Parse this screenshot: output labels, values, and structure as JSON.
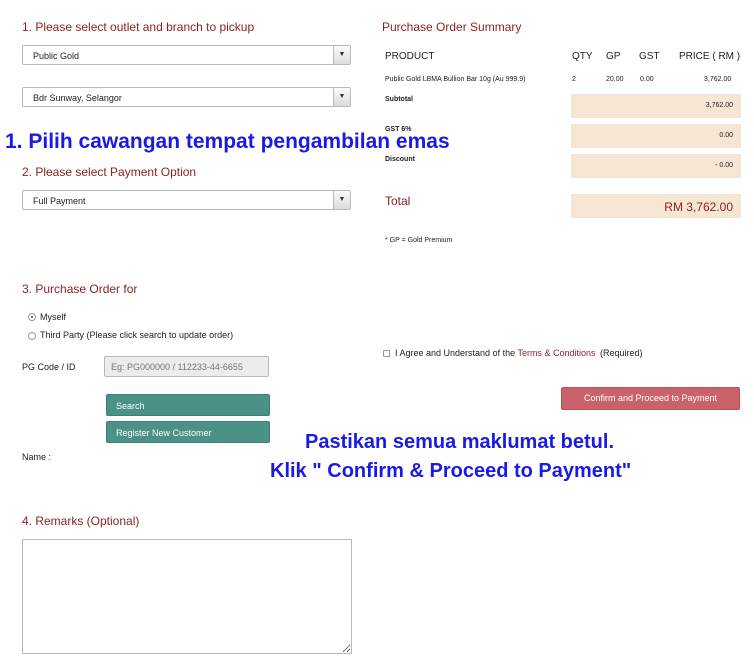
{
  "pickup": {
    "title": "1. Please select outlet and branch to pickup",
    "outlet": "Public Gold",
    "branch": "Bdr Sunway, Selangor"
  },
  "overlay_top": "1. Pilih cawangan tempat pengambilan emas",
  "payment": {
    "title": "2. Please select Payment Option",
    "option": "Full Payment"
  },
  "purchase_for": {
    "title": "3. Purchase Order for",
    "myself": "Myself",
    "third_party": "Third Party (Please click search to update order)",
    "pg_code_label": "PG Code / ID",
    "pg_code_placeholder": "Eg: PG000000 / 112233-44-6655",
    "search_label": "Search",
    "register_label": "Register New Customer",
    "name_label": "Name :"
  },
  "remarks": {
    "title": "4. Remarks (Optional)"
  },
  "summary": {
    "title": "Purchase Order Summary",
    "headers": {
      "product": "PRODUCT",
      "qty": "QTY",
      "gp": "GP",
      "gst": "GST",
      "price": "PRICE ( RM )"
    },
    "row": {
      "product": "Public Gold LBMA Bullion Bar 10g (Au 999.9)",
      "qty": "2",
      "gp": "20.00",
      "gst": "0.00",
      "price": "3,762.00"
    },
    "subtotal_label": "Subtotal",
    "subtotal_value": "3,762.00",
    "gst_label": "GST 6%",
    "gst_value": "0.00",
    "discount_label": "Discount",
    "discount_value": "- 0.00",
    "total_label": "Total",
    "total_value": "RM 3,762.00",
    "gp_note": "* GP = Gold Premium"
  },
  "agree": {
    "prefix": "I Agree and Understand of the",
    "link": "Terms & Conditions",
    "suffix": "(Required)"
  },
  "confirm_label": "Confirm and Proceed to Payment",
  "overlay_bottom_1": "Pastikan semua maklumat betul.",
  "overlay_bottom_2": "Klik \" Confirm & Proceed to Payment\""
}
